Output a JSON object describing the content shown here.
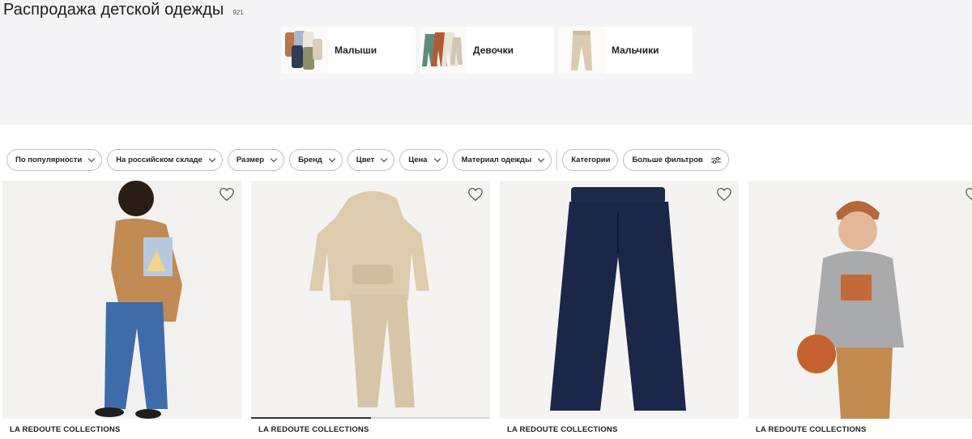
{
  "header": {
    "title": "Распродажа детской одежды",
    "count": "921"
  },
  "categories": [
    {
      "label": "Малыши",
      "icon": "baby-bodysuits-image"
    },
    {
      "label": "Девочки",
      "icon": "girls-clothes-image"
    },
    {
      "label": "Мальчики",
      "icon": "boys-trousers-image"
    }
  ],
  "filters": [
    "По популярности",
    "На российском складе",
    "Размер",
    "Бренд",
    "Цвет",
    "Цена",
    "Материал одежды",
    "Категории",
    "Больше фильтров"
  ],
  "products": [
    {
      "brand": "LA REDOUTE COLLECTIONS",
      "image": "boy-brown-sweatshirt-jeans"
    },
    {
      "brand": "LA REDOUTE COLLECTIONS",
      "image": "beige-hoodie-joggers-set",
      "gallery_progress": 0.5
    },
    {
      "brand": "LA REDOUTE COLLECTIONS",
      "image": "navy-corduroy-trousers"
    },
    {
      "brand": "LA REDOUTE COLLECTIONS",
      "image": "boy-grey-sweatshirt-basketball"
    }
  ],
  "colors": {
    "top_bg": "#f4f4f6",
    "chip_border": "#bdbdbd",
    "text": "#222222"
  }
}
